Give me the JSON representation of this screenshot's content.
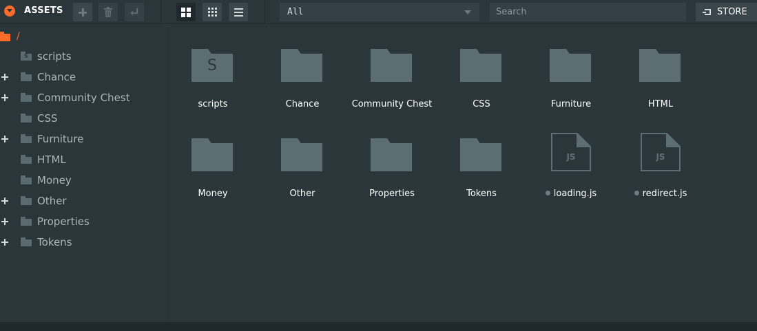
{
  "toolbar": {
    "title": "ASSETS",
    "filter_value": "All",
    "search_placeholder": "Search",
    "store_label": "STORE"
  },
  "sidebar": {
    "root_label": "/",
    "items": [
      {
        "label": "scripts",
        "expandable": false,
        "icon": "scripts-folder-icon"
      },
      {
        "label": "Chance",
        "expandable": true,
        "icon": "folder-icon"
      },
      {
        "label": "Community Chest",
        "expandable": true,
        "icon": "folder-icon"
      },
      {
        "label": "CSS",
        "expandable": false,
        "icon": "folder-icon"
      },
      {
        "label": "Furniture",
        "expandable": true,
        "icon": "folder-icon"
      },
      {
        "label": "HTML",
        "expandable": false,
        "icon": "folder-icon"
      },
      {
        "label": "Money",
        "expandable": false,
        "icon": "folder-icon"
      },
      {
        "label": "Other",
        "expandable": true,
        "icon": "folder-icon"
      },
      {
        "label": "Properties",
        "expandable": true,
        "icon": "folder-icon"
      },
      {
        "label": "Tokens",
        "expandable": true,
        "icon": "folder-icon"
      }
    ]
  },
  "grid": {
    "items": [
      {
        "label": "scripts",
        "type": "scripts-folder",
        "icon_letter": "S"
      },
      {
        "label": "Chance",
        "type": "folder"
      },
      {
        "label": "Community Chest",
        "type": "folder"
      },
      {
        "label": "CSS",
        "type": "folder"
      },
      {
        "label": "Furniture",
        "type": "folder"
      },
      {
        "label": "HTML",
        "type": "folder"
      },
      {
        "label": "Money",
        "type": "folder"
      },
      {
        "label": "Other",
        "type": "folder"
      },
      {
        "label": "Properties",
        "type": "folder"
      },
      {
        "label": "Tokens",
        "type": "folder"
      },
      {
        "label": "loading.js",
        "type": "js-file",
        "icon_text": "JS"
      },
      {
        "label": "redirect.js",
        "type": "js-file",
        "icon_text": "JS"
      }
    ]
  },
  "colors": {
    "accent": "#fb6c2a",
    "background": "#2b363b",
    "icon": "#5d6e73"
  }
}
